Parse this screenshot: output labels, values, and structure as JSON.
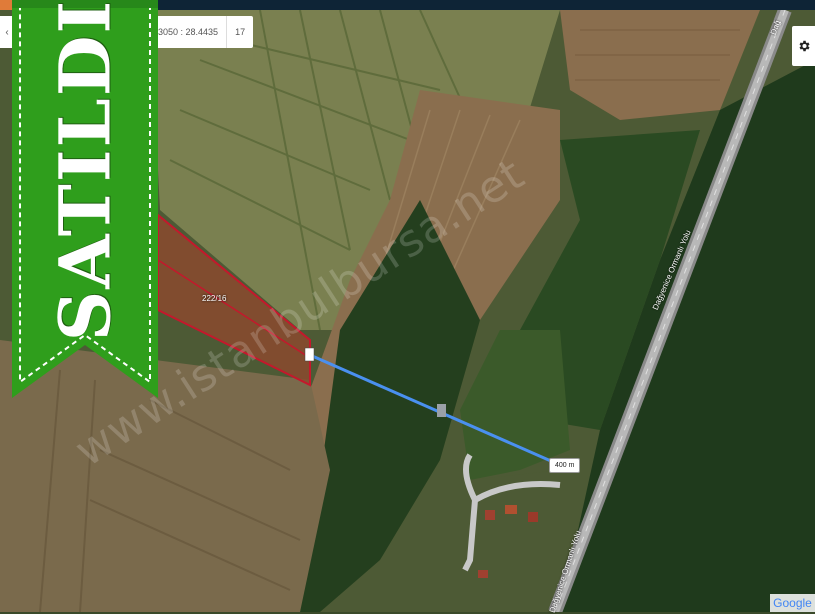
{
  "coords": {
    "lonlat": "3050 : 28.4435",
    "zoom": "17"
  },
  "left_stub": "‹",
  "parcel_label": "222/16",
  "distance_label": "400 m",
  "road_labels": [
    "Dağyenice Ormanlı Yolu",
    "Dağyenice Ormanlı Yolu",
    "Dağ"
  ],
  "stamp_text": "SATILDI",
  "watermark": "www.istanbulbursa.net",
  "attribution": "Google",
  "colors": {
    "ribbon": "#2f9e1c",
    "parcel_border": "#c4182c",
    "measure_line": "#4a90f0",
    "topbar": "#0e2436"
  },
  "icons": {
    "settings": "gear-icon"
  }
}
